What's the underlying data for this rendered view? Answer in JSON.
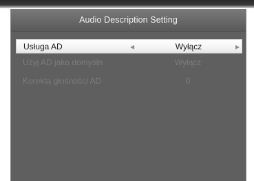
{
  "dialog": {
    "title": "Audio Description Setting"
  },
  "settings": [
    {
      "label": "Usługa AD",
      "value": "Wyłącz",
      "selected": true
    },
    {
      "label": "Użyj AD jako domyśln",
      "value": "Wyłącz",
      "selected": false
    },
    {
      "label": "Korekta głośności AD",
      "value": "0",
      "selected": false
    }
  ],
  "icons": {
    "left": "◀",
    "right": "▶"
  }
}
